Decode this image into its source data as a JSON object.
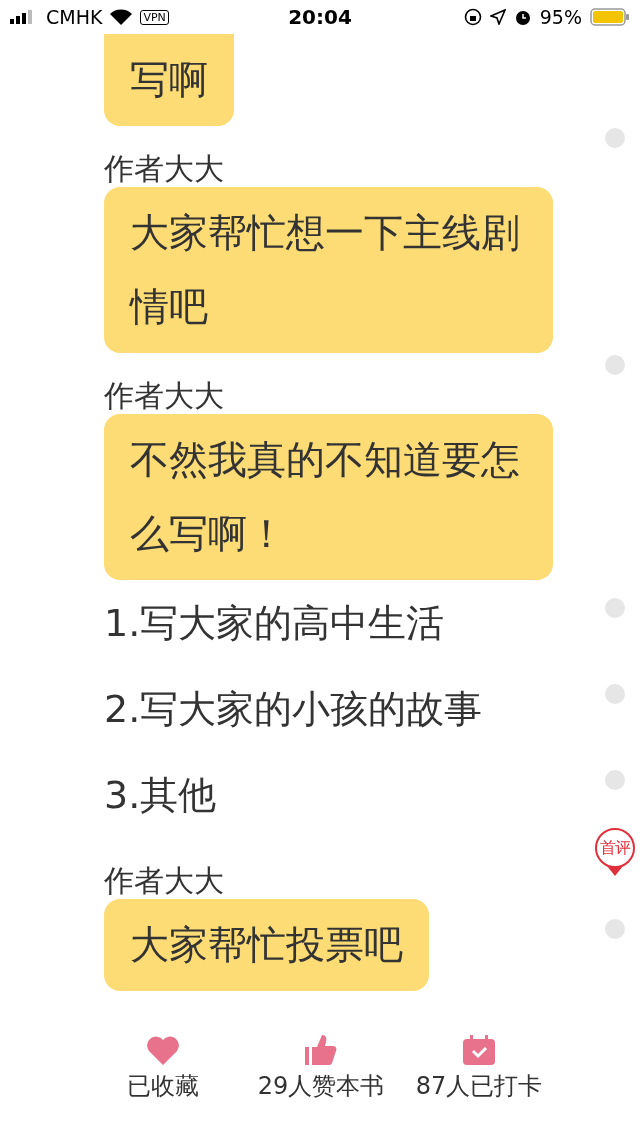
{
  "status_bar": {
    "carrier": "CMHK",
    "vpn": "VPN",
    "time": "20:04",
    "battery": "95%"
  },
  "rows": [
    {
      "kind": "bubble",
      "text": "写啊",
      "comment_dot": false
    },
    {
      "kind": "author",
      "text": "作者大大",
      "comment_dot": true
    },
    {
      "kind": "bubble",
      "text": "大家帮忙想一下主线剧情吧",
      "comment_dot": false
    },
    {
      "kind": "author",
      "text": "作者大大",
      "comment_dot": true
    },
    {
      "kind": "bubble",
      "text": "不然我真的不知道要怎么写啊！",
      "comment_dot": false
    },
    {
      "kind": "line",
      "text": "1.写大家的高中生活",
      "comment_dot": true
    },
    {
      "kind": "line",
      "text": "2.写大家的小孩的故事",
      "comment_dot": true
    },
    {
      "kind": "line",
      "text": "3.其他",
      "comment_dot": true
    },
    {
      "kind": "author",
      "text": "作者大大",
      "comment_dot": false,
      "badge": "首评"
    },
    {
      "kind": "bubble",
      "text": "大家帮忙投票吧",
      "comment_dot": true
    }
  ],
  "actions": [
    {
      "kind": "heart",
      "label": "已收藏"
    },
    {
      "kind": "thumb",
      "label": "29人赞本书"
    },
    {
      "kind": "calendar",
      "label": "87人已打卡"
    }
  ]
}
